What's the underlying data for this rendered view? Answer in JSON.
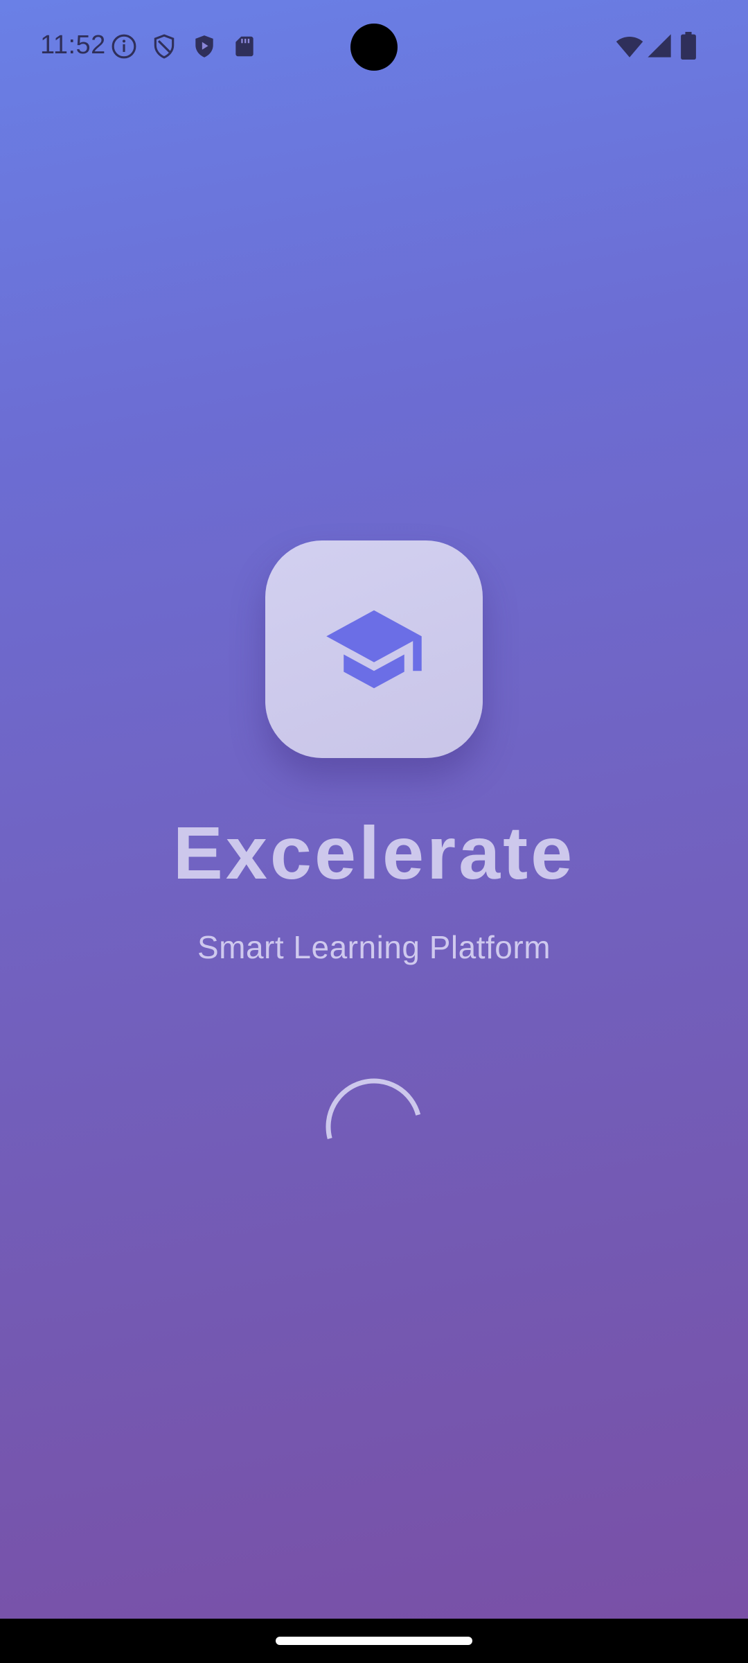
{
  "status_bar": {
    "time": "11:52",
    "icons_left": [
      "info-icon",
      "shield-outline-icon",
      "shield-play-icon",
      "sd-card-icon"
    ],
    "icons_right": [
      "wifi-icon",
      "cell-signal-icon",
      "battery-icon"
    ]
  },
  "splash": {
    "logo_icon": "graduation-cap-icon",
    "title": "Excelerate",
    "subtitle": "Smart Learning Platform",
    "loading_indicator": "circular-progress-spinner"
  },
  "colors": {
    "gradient_top": "#6a80e6",
    "gradient_bottom": "#7a4fa5",
    "card": "#cfcbee",
    "accent": "#6b6ee6",
    "text_light": "#cdc8ec",
    "status_icons": "#2f2f5a"
  }
}
